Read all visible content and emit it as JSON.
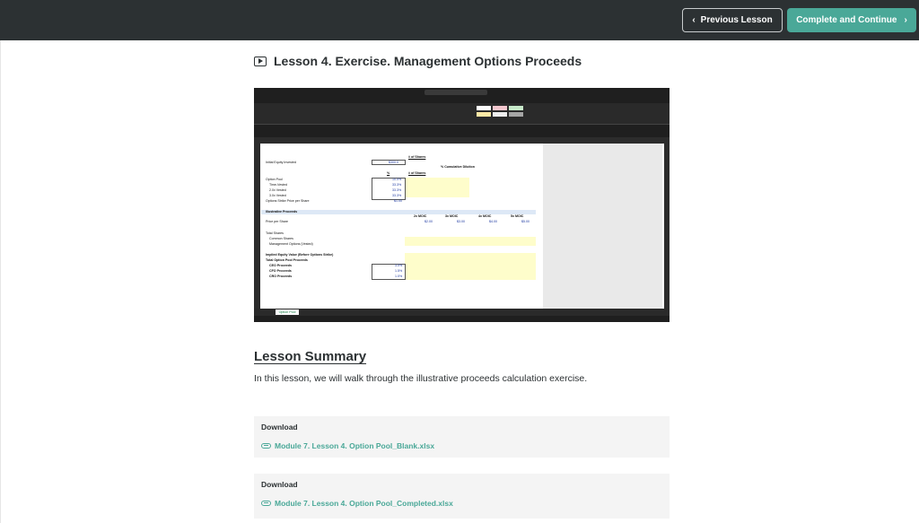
{
  "header": {
    "prev_label": "Previous Lesson",
    "next_label": "Complete and Continue",
    "prev_icon": "chevron-left-icon",
    "next_icon": "chevron-right-icon"
  },
  "lesson": {
    "icon": "video-icon",
    "title": "Lesson 4. Exercise. Management Options Proceeds"
  },
  "spreadsheet": {
    "sheet_tab": "Option Pool",
    "rows": [
      {
        "label": "# of Shares"
      },
      {
        "label": "Initial Equity Invested",
        "value": "$300.0"
      },
      {
        "label": "% Cumulative Dilution"
      },
      {
        "label": "%"
      },
      {
        "label": "# of Shares"
      },
      {
        "label": "Option Pool",
        "value": "10.0%"
      },
      {
        "label": "Time-Vested",
        "value": "33.3%"
      },
      {
        "label": "2.0x Vested",
        "value": "33.3%"
      },
      {
        "label": "3.0x Vested",
        "value": "33.3%"
      },
      {
        "label": "Options Strike Price per Share",
        "value": "$1.00"
      },
      {
        "label": "Illustrative Proceeds"
      },
      {
        "label": "Price per Share"
      },
      {
        "label": "Total Shares"
      },
      {
        "label": "Common Shares"
      },
      {
        "label": "Management Options (Vested)"
      },
      {
        "label": "Implied Equity Value (Before Options Strike)"
      },
      {
        "label": "Total Option Pool Proceeds"
      },
      {
        "label": "CEO Proceeds",
        "value": "3.0%"
      },
      {
        "label": "CFO Proceeds",
        "value": "1.5%"
      },
      {
        "label": "CRO Proceeds",
        "value": "1.0%"
      }
    ],
    "moic_headers": [
      "2x MOIC",
      "3x MOIC",
      "4x MOIC",
      "5x MOIC"
    ],
    "moic_prices": [
      "$2.00",
      "$3.00",
      "$4.00",
      "$5.00"
    ]
  },
  "summary": {
    "title": "Lesson Summary",
    "text": "In this lesson, we will walk through the illustrative proceeds calculation exercise."
  },
  "downloads": [
    {
      "label": "Download",
      "file": "Module 7. Lesson 4. Option Pool_Blank.xlsx",
      "icon": "paperclip-icon"
    },
    {
      "label": "Download",
      "file": "Module 7. Lesson 4. Option Pool_Completed.xlsx",
      "icon": "paperclip-icon"
    }
  ],
  "colors": {
    "topbar": "#2c3133",
    "accent": "#4aa898",
    "text": "#2c3133"
  }
}
